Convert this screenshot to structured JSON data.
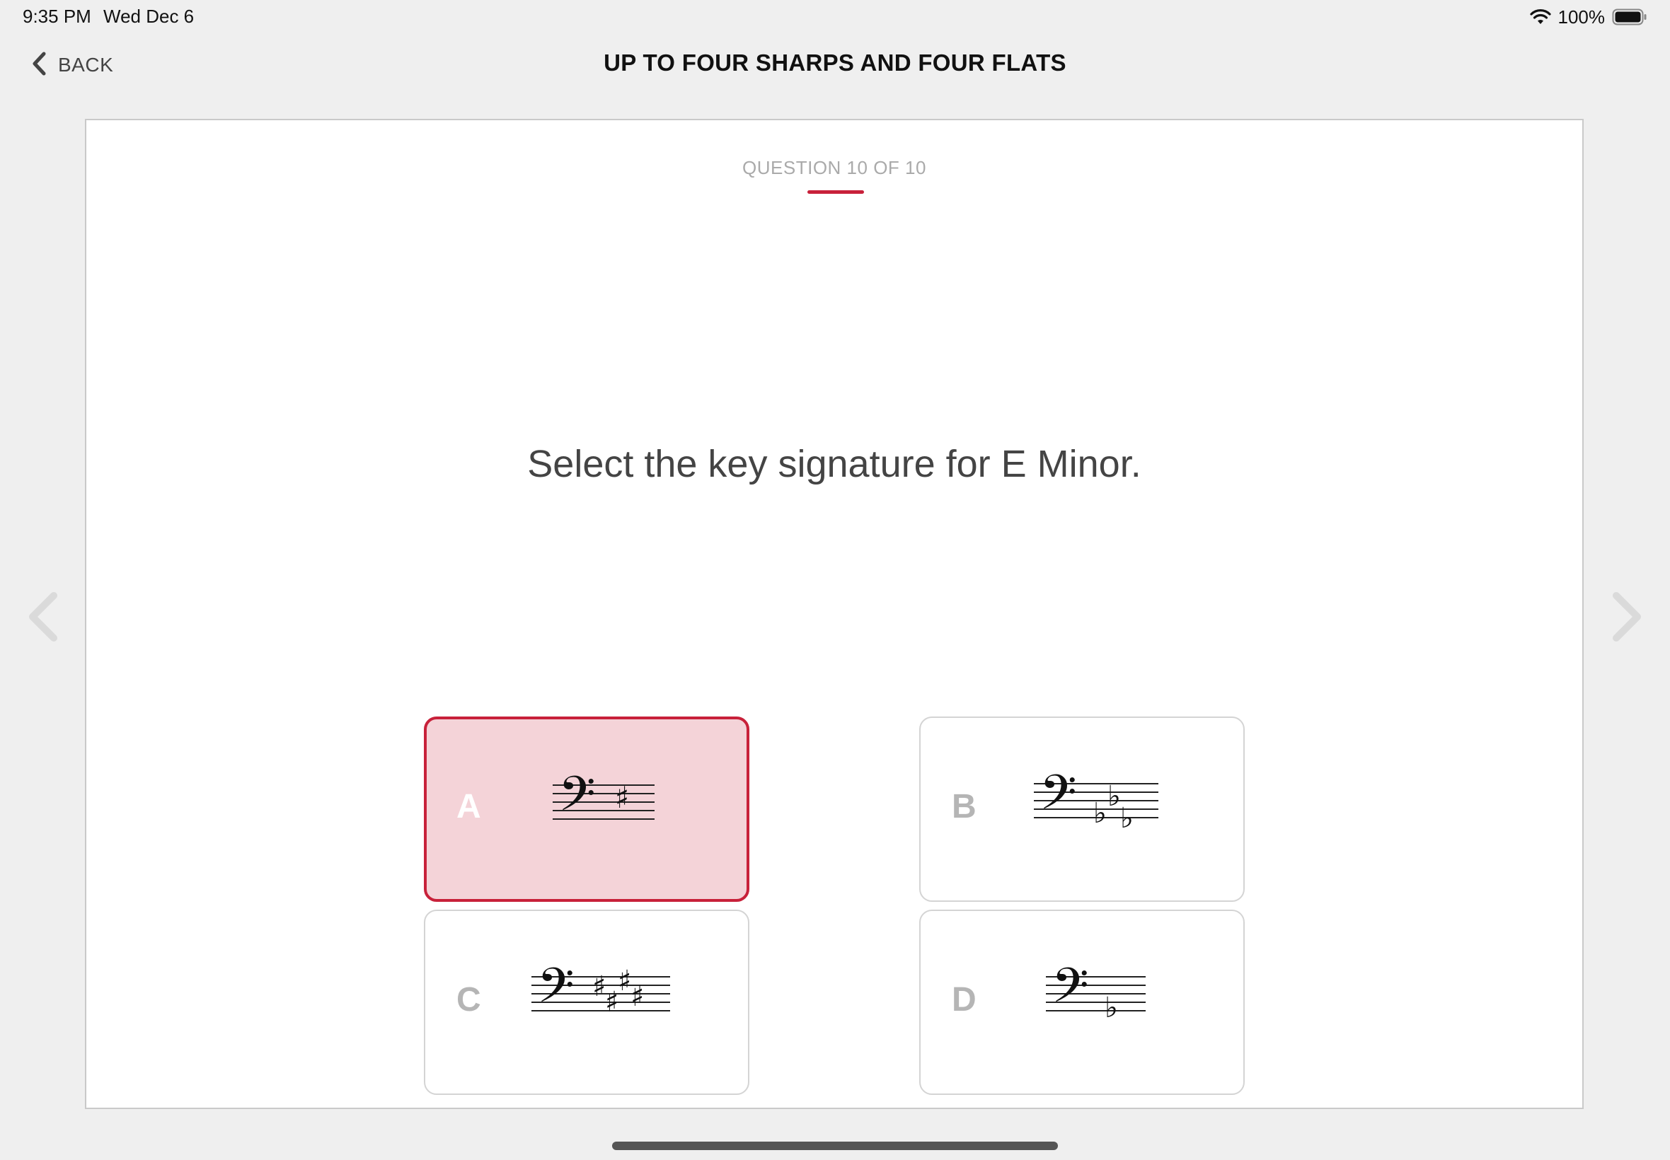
{
  "status_bar": {
    "time": "9:35 PM",
    "date": "Wed Dec 6",
    "battery_percent": "100%",
    "wifi_icon": "wifi-icon",
    "battery_icon": "battery-full-icon"
  },
  "nav": {
    "back_label": "BACK",
    "back_icon": "chevron-left-icon",
    "title": "UP TO FOUR SHARPS AND FOUR FLATS"
  },
  "quiz": {
    "progress_label": "QUESTION 10 OF 10",
    "question": "Select the key signature for E Minor.",
    "accent_color": "#c8213a",
    "options": [
      {
        "letter": "A",
        "clef": "bass",
        "accidental": "sharp",
        "count": 1,
        "selected": true
      },
      {
        "letter": "B",
        "clef": "bass",
        "accidental": "flat",
        "count": 3,
        "selected": false
      },
      {
        "letter": "C",
        "clef": "bass",
        "accidental": "sharp",
        "count": 4,
        "selected": false
      },
      {
        "letter": "D",
        "clef": "bass",
        "accidental": "flat",
        "count": 1,
        "selected": false
      }
    ]
  },
  "side_nav": {
    "prev_icon": "chevron-left-icon",
    "next_icon": "chevron-right-icon"
  }
}
